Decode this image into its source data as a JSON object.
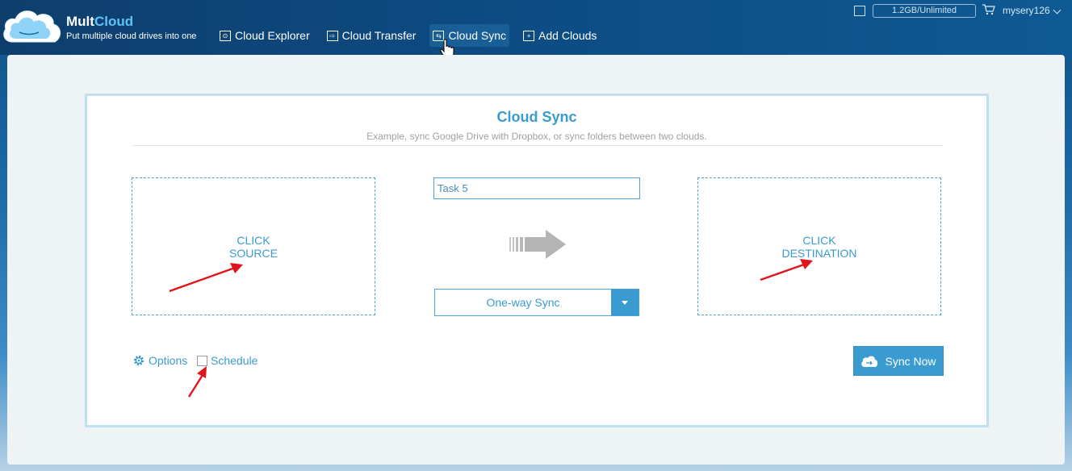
{
  "header": {
    "brand_mult": "Mult",
    "brand_cloud": "Cloud",
    "tagline": "Put multiple cloud drives into one",
    "nav": [
      {
        "label": "Cloud Explorer",
        "icon": "explorer-icon"
      },
      {
        "label": "Cloud Transfer",
        "icon": "transfer-icon"
      },
      {
        "label": "Cloud Sync",
        "icon": "sync-icon",
        "active": true
      },
      {
        "label": "Add Clouds",
        "icon": "add-icon"
      }
    ],
    "quota": "1.2GB/Unlimited",
    "username": "mysery126"
  },
  "sync": {
    "title": "Cloud Sync",
    "subtitle": "Example, sync Google Drive with Dropbox, or sync folders between two clouds.",
    "source_line1": "CLICK",
    "source_line2": "SOURCE",
    "dest_line1": "CLICK",
    "dest_line2": "DESTINATION",
    "task_name": "Task 5",
    "mode": "One-way Sync",
    "options_label": "Options",
    "schedule_label": "Schedule",
    "schedule_checked": false,
    "sync_now_label": "Sync Now"
  },
  "colors": {
    "accent": "#3a9bd1",
    "header_bg": "#0d4c84",
    "annotation": "#e0141b"
  }
}
